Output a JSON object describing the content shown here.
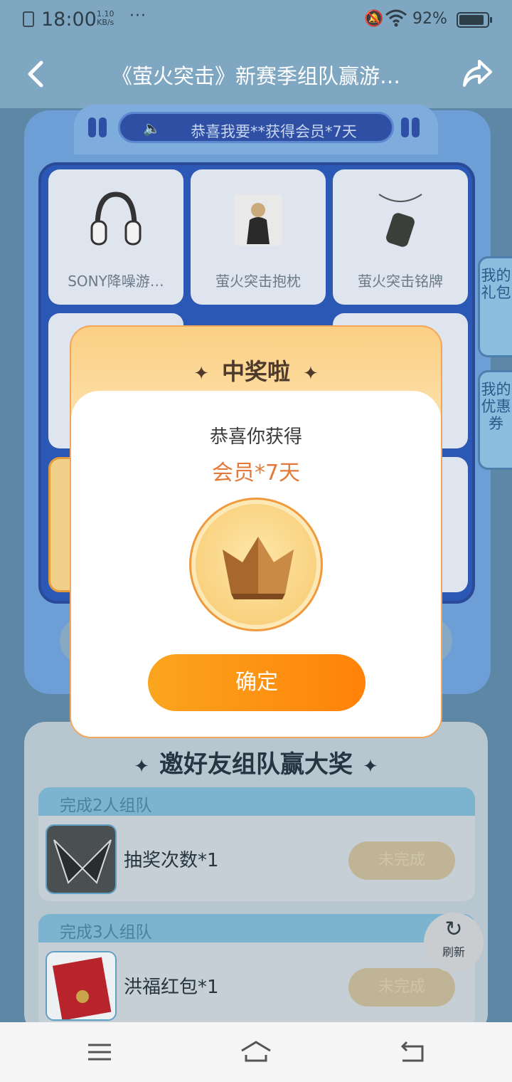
{
  "status_bar": {
    "time": "18:00",
    "net_speed_value": "1.10",
    "net_speed_unit": "KB/s",
    "dots": "···",
    "battery_percent": "92%",
    "battery_level": 0.92
  },
  "header": {
    "title": "《萤火突击》新赛季组队赢游…"
  },
  "marquee": {
    "text": "恭喜我要**获得会员*7天"
  },
  "prizes": [
    {
      "label": "SONY降噪游…",
      "icon": "headphones-icon"
    },
    {
      "label": "萤火突击抱枕",
      "icon": "pillow-icon"
    },
    {
      "label": "萤火突击铭牌",
      "icon": "dogtag-icon"
    }
  ],
  "side_tabs": {
    "gifts": "我的礼包",
    "coupons": "我的优惠券"
  },
  "team_section": {
    "title": "邀好友组队赢大奖",
    "tasks": [
      {
        "head": "完成2人组队",
        "name": "抽奖次数*1",
        "status": "未完成",
        "icon": "game-logo-icon"
      },
      {
        "head": "完成3人组队",
        "name": "洪福红包*1",
        "status": "未完成",
        "icon": "red-envelope-icon"
      }
    ]
  },
  "refresh": {
    "label": "刷新"
  },
  "dialog": {
    "title": "中奖啦",
    "line1": "恭喜你获得",
    "prize": "会员*7天",
    "icon": "crown-icon",
    "confirm_label": "确定"
  },
  "colors": {
    "accent_orange": "#ff8208",
    "prize_text": "#e47a3a"
  }
}
